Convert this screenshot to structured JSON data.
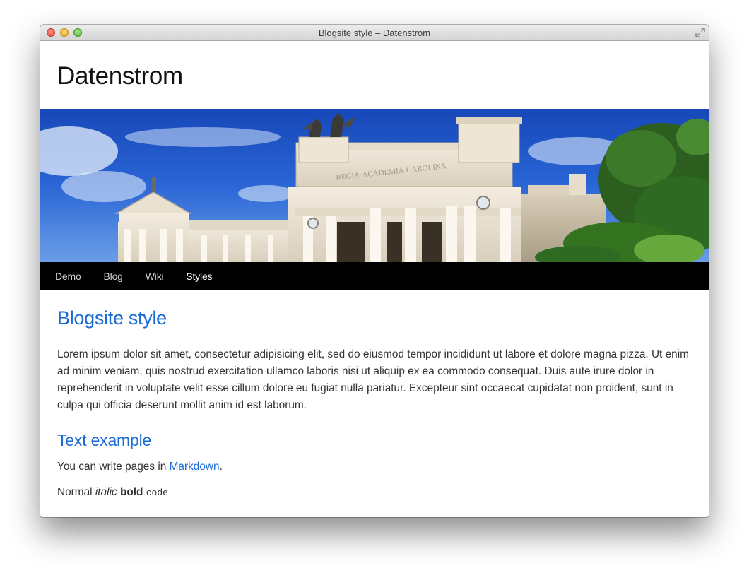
{
  "window": {
    "title": "Blogsite style – Datenstrom"
  },
  "site": {
    "name": "Datenstrom"
  },
  "banner": {
    "inscription": "REGIA·ACADEMIA·CAROLINA"
  },
  "nav": {
    "items": [
      {
        "label": "Demo",
        "active": false
      },
      {
        "label": "Blog",
        "active": false
      },
      {
        "label": "Wiki",
        "active": false
      },
      {
        "label": "Styles",
        "active": true
      }
    ]
  },
  "content": {
    "title": "Blogsite style",
    "paragraph": "Lorem ipsum dolor sit amet, consectetur adipisicing elit, sed do eiusmod tempor incididunt ut labore et dolore magna pizza. Ut enim ad minim veniam, quis nostrud exercitation ullamco laboris nisi ut aliquip ex ea commodo consequat. Duis aute irure dolor in reprehenderit in voluptate velit esse cillum dolore eu fugiat nulla pariatur. Excepteur sint occaecat cupidatat non proident, sunt in culpa qui officia deserunt mollit anim id est laborum.",
    "subheading": "Text example",
    "markdown_line": {
      "prefix": "You can write pages in ",
      "link": "Markdown",
      "suffix": "."
    },
    "format_line": {
      "normal": "Normal",
      "italic": "italic",
      "bold": "bold",
      "code": "code"
    }
  },
  "colors": {
    "heading": "#1a6ad4",
    "link": "#1a6ad4",
    "nav_background": "#000000"
  }
}
